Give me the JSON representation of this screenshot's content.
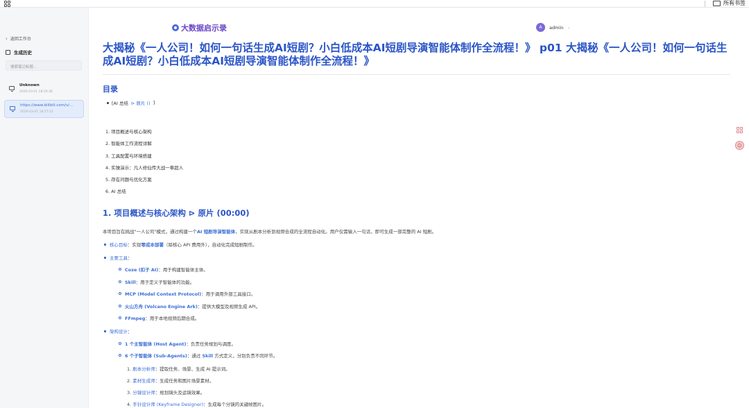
{
  "browser": {
    "bookmarks_label": "所有书签"
  },
  "sidebar": {
    "back_label": "返回工作台",
    "history_title": "生成历史",
    "search_placeholder": "搜索笔记标题...",
    "items": [
      {
        "title": "Unknown",
        "time": "2026-03-01 18:29:38"
      },
      {
        "title": "https://www.bilibili.com/v/...",
        "time": "2026-03-01 18:27:12"
      }
    ]
  },
  "header": {
    "brand": "大数据启示录",
    "user": {
      "avatar_letter": "A",
      "name": "admin"
    }
  },
  "doc": {
    "title": "大揭秘《一人公司！如何一句话生成AI短剧？小白低成本AI短剧导演智能体制作全流程！》 p01 大揭秘《一人公司！如何一句话生成AI短剧？小白低成本AI短剧导演智能体制作全流程！》",
    "toc_heading": "目录",
    "toc_item_prefix": "[AI 总结",
    "toc_item_link": "⊳ 原片 ()",
    "toc_item_suffix": "]",
    "outline": [
      "1. 项目概述与核心架构",
      "2. 智能体工作流程详解",
      "3. 工具配置与环境搭建",
      "4. 实操演示：凡人修仙传大战一拳超人",
      "5. 存在问题与优化方案",
      "6. AI 总结"
    ],
    "section1_heading": "1. 项目概述与核心架构 ⊳ 原片 (00:00)",
    "intro_before": "本项目旨在挑战\"一人公司\"模式，通过构建一个",
    "intro_link": "AI 短剧导演智能体",
    "intro_after": "，实现从剧本分析到视频合成的全流程自动化。用户仅需输入一句话，即可生成一部完整的 AI 短剧。",
    "goal_label": "核心目标",
    "goal_text_a": "：实现",
    "goal_kw": "零成本部署",
    "goal_text_b": "（除核心 API 费用外），自动化完成短剧制作。",
    "tools_label": "主要工具",
    "tools_colon": "：",
    "tools": [
      {
        "name": "Coze (扣子 AI)",
        "desc": "：用于构建智能体主体。"
      },
      {
        "name": "Skill",
        "desc": "：用于定义子智能体的功能。"
      },
      {
        "name": "MCP (Model Context Protocol)",
        "desc": "：用于调用外部工具接口。"
      },
      {
        "name": "火山方舟 (Volcano Engine Ark)",
        "desc": "：提供大模型及视频生成 API。"
      },
      {
        "name": "FFmpeg",
        "desc": "：用于本地视频后期合成。"
      }
    ],
    "arch_label": "架构设计",
    "arch_colon": "：",
    "arch_main_name": "1 个主智能体 (Host Agent)",
    "arch_main_desc": "：负责任务规划与调度。",
    "arch_sub_name": "6 个子智能体 (Sub-Agents)",
    "arch_sub_mid": "：通过 ",
    "arch_sub_kw": "Skill",
    "arch_sub_desc": " 方式定义，分别负责不同环节。",
    "sub_agents": [
      {
        "num": "1.",
        "name": "剧本分析师",
        "desc": "：提取任务、场景、生成 AI 提示词。"
      },
      {
        "num": "2.",
        "name": "素材生成师",
        "desc": "：生成任务和图片场景素材。"
      },
      {
        "num": "3.",
        "name": "分镜设计师",
        "desc": "：规划镜头及运镜效果。"
      },
      {
        "num": "4.",
        "name": "手针设计师 (Keyframe Designer)",
        "desc": "：生成每个分镜的关键帧图片。"
      }
    ]
  },
  "colors": {
    "accent": "#2b55c7",
    "link": "#3b6fd6",
    "brand": "#6a45c9"
  }
}
